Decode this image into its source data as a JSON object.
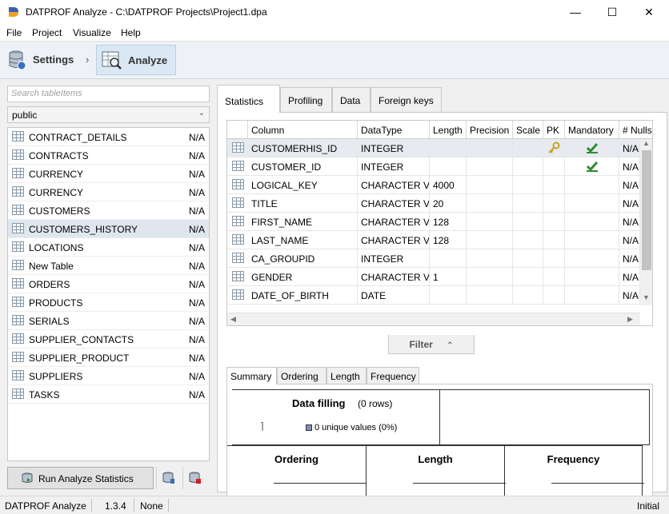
{
  "window": {
    "title": "DATPROF Analyze - C:\\DATPROF Projects\\Project1.dpa",
    "minimize": "—",
    "maximize": "☐",
    "close": "✕"
  },
  "menu": [
    "File",
    "Project",
    "Visualize",
    "Help"
  ],
  "toolbar": {
    "settings_label": "Settings",
    "separator": "›",
    "analyze_label": "Analyze"
  },
  "sidebar": {
    "search_placeholder": "Search tableItems",
    "schema": "public",
    "tables": [
      {
        "name": "CONTRACT_DETAILS",
        "status": "N/A"
      },
      {
        "name": "CONTRACTS",
        "status": "N/A"
      },
      {
        "name": "CURRENCY",
        "status": "N/A"
      },
      {
        "name": "CURRENCY",
        "status": "N/A"
      },
      {
        "name": "CUSTOMERS",
        "status": "N/A"
      },
      {
        "name": "CUSTOMERS_HISTORY",
        "status": "N/A"
      },
      {
        "name": "LOCATIONS",
        "status": "N/A"
      },
      {
        "name": "New Table",
        "status": "N/A"
      },
      {
        "name": "ORDERS",
        "status": "N/A"
      },
      {
        "name": "PRODUCTS",
        "status": "N/A"
      },
      {
        "name": "SERIALS",
        "status": "N/A"
      },
      {
        "name": "SUPPLIER_CONTACTS",
        "status": "N/A"
      },
      {
        "name": "SUPPLIER_PRODUCT",
        "status": "N/A"
      },
      {
        "name": "SUPPLIERS",
        "status": "N/A"
      },
      {
        "name": "TASKS",
        "status": "N/A"
      }
    ],
    "run_button": "Run Analyze Statistics"
  },
  "tabs": [
    "Statistics",
    "Profiling",
    "Data",
    "Foreign keys"
  ],
  "grid": {
    "headers": [
      "Column",
      "DataType",
      "Length",
      "Precision",
      "Scale",
      "PK",
      "Mandatory",
      "# Nulls"
    ],
    "rows": [
      {
        "column": "CUSTOMERHIS_ID",
        "datatype": "INTEGER",
        "length": "",
        "pk": true,
        "mandatory": true,
        "nulls": "N/A"
      },
      {
        "column": "CUSTOMER_ID",
        "datatype": "INTEGER",
        "length": "",
        "pk": false,
        "mandatory": true,
        "nulls": "N/A"
      },
      {
        "column": "LOGICAL_KEY",
        "datatype": "CHARACTER VARYING",
        "length": "4000",
        "pk": false,
        "mandatory": false,
        "nulls": "N/A"
      },
      {
        "column": "TITLE",
        "datatype": "CHARACTER VARYING",
        "length": "20",
        "pk": false,
        "mandatory": false,
        "nulls": "N/A"
      },
      {
        "column": "FIRST_NAME",
        "datatype": "CHARACTER VARYING",
        "length": "128",
        "pk": false,
        "mandatory": false,
        "nulls": "N/A"
      },
      {
        "column": "LAST_NAME",
        "datatype": "CHARACTER VARYING",
        "length": "128",
        "pk": false,
        "mandatory": false,
        "nulls": "N/A"
      },
      {
        "column": "CA_GROUPID",
        "datatype": "INTEGER",
        "length": "",
        "pk": false,
        "mandatory": false,
        "nulls": "N/A"
      },
      {
        "column": "GENDER",
        "datatype": "CHARACTER VARYING",
        "length": "1",
        "pk": false,
        "mandatory": false,
        "nulls": "N/A"
      },
      {
        "column": "DATE_OF_BIRTH",
        "datatype": "DATE",
        "length": "",
        "pk": false,
        "mandatory": false,
        "nulls": "N/A"
      }
    ],
    "filter_label": "Filter"
  },
  "sub_tabs": [
    "Summary",
    "Ordering",
    "Length",
    "Frequency"
  ],
  "summary": {
    "data_filling_title": "Data filling",
    "data_filling_rows": "(0 rows)",
    "unique_values": "0 unique values (0%)",
    "ordering": "Ordering",
    "length": "Length",
    "frequency": "Frequency"
  },
  "status_bar": {
    "app": "DATPROF Analyze",
    "version": "1.3.4",
    "selection": "None",
    "state": "Initial"
  },
  "colors": {
    "accent": "#dbe8f4",
    "selected_row": "#dfe6ee",
    "check": "#2e8b2e",
    "key": "#c9a227"
  }
}
